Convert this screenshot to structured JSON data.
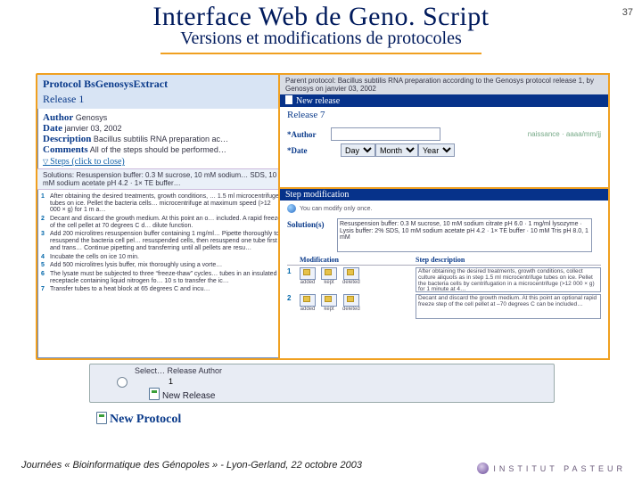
{
  "slide": {
    "page_number": "37",
    "title": "Interface Web de Geno. Script",
    "subtitle": "Versions et modifications de protocoles",
    "footer": "Journées « Bioinformatique des Génopoles » - Lyon-Gerland, 22 octobre 2003",
    "logo_text": "INSTITUT PASTEUR"
  },
  "bg_row": {
    "columns": "Select…    Release    Author",
    "release_no": "1",
    "new_release": "New Release"
  },
  "new_protocol_link": "New Protocol",
  "panel1": {
    "protocol": "Protocol BsGenosysExtract",
    "release": "Release 1",
    "author_label": "Author",
    "author": "Genosys",
    "date_label": "Date",
    "date": "janvier 03, 2002",
    "desc_label": "Description",
    "desc": "Bacillus subtilis RNA preparation ac…",
    "comments_label": "Comments",
    "comments": "All of the steps should be performed…",
    "steps_link": "Steps (click to close)",
    "solutions_header": "Solutions: Resuspension buffer: 0.3 M sucrose, 10 mM sodium… SDS, 10 mM sodium acetate pH 4.2 · 1× TE buffer…",
    "steps": [
      "After obtaining the desired treatments, growth conditions, … 1.5 ml microcentrifuge tubes on ice. Pellet the bacteria cells… microcentrifuge at maximum speed (>12 000 × g) for 1 m a…",
      "Decant and discard the growth medium. At this point an o… included. A rapid freeze of the cell pellet at 70 degrees C d… dilute function.",
      "Add 200 microlitres resuspension buffer containing 1 mg/ml… Pipette thoroughly to resuspend the bacteria cell pel… resuspended cells, then resuspend one tube first and trans… Continue pipetting and transferring until all pellets are resu…",
      "Incubate the cells on ice 10 min.",
      "Add 500 microlitres lysis buffer, mix thoroughly using a vorte…",
      "The lysate must be subjected to three “freeze-thaw” cycles… tubes in an insulated receptacle containing liquid nitrogen fo… 10 s to transfer the ic…",
      "Transfer tubes to a heat block at 65 degrees C and incu…"
    ]
  },
  "panel2": {
    "parent": "Parent protocol: Bacillus subtilis RNA preparation according to the Genosys protocol release 1, by Genosys on janvier 03, 2002",
    "new_release_label": "New release",
    "release7": "Release 7",
    "author_label": "*Author",
    "date_label": "*Date",
    "date_day": "Day",
    "date_month": "Month",
    "date_year": "Year",
    "hint": "naissance · aaaa/mm/jj"
  },
  "panel3": {
    "strip": "Step modification",
    "hint": "You can modify only once.",
    "solutions_label": "Solution(s)",
    "solutions_text": "Resuspension buffer: 0.3 M sucrose, 10 mM sodium citrate pH 6.0 · 1 mg/ml lysozyme · Lysis buffer: 2% SDS, 10 mM sodium acetate pH 4.2 · 1× TE buffer · 10 mM Tris pH 8.0, 1 mM",
    "col_mod": "Modification",
    "col_desc": "Step description",
    "icons": [
      "added",
      "kept",
      "deleted"
    ],
    "rows": [
      {
        "n": "1",
        "desc": "After obtaining the desired treatments, growth conditions, collect culture aliquots as in step 1.5 ml microcentrifuge tubes on ice. Pellet the bacteria cells by centrifugation in a microcentrifuge (>12 000 × g) for 1 minute at 4…"
      },
      {
        "n": "2",
        "desc": "Decant and discard the growth medium. At this point an optional rapid freeze step of the cell pellet at –70 degrees C can be included…"
      }
    ]
  }
}
